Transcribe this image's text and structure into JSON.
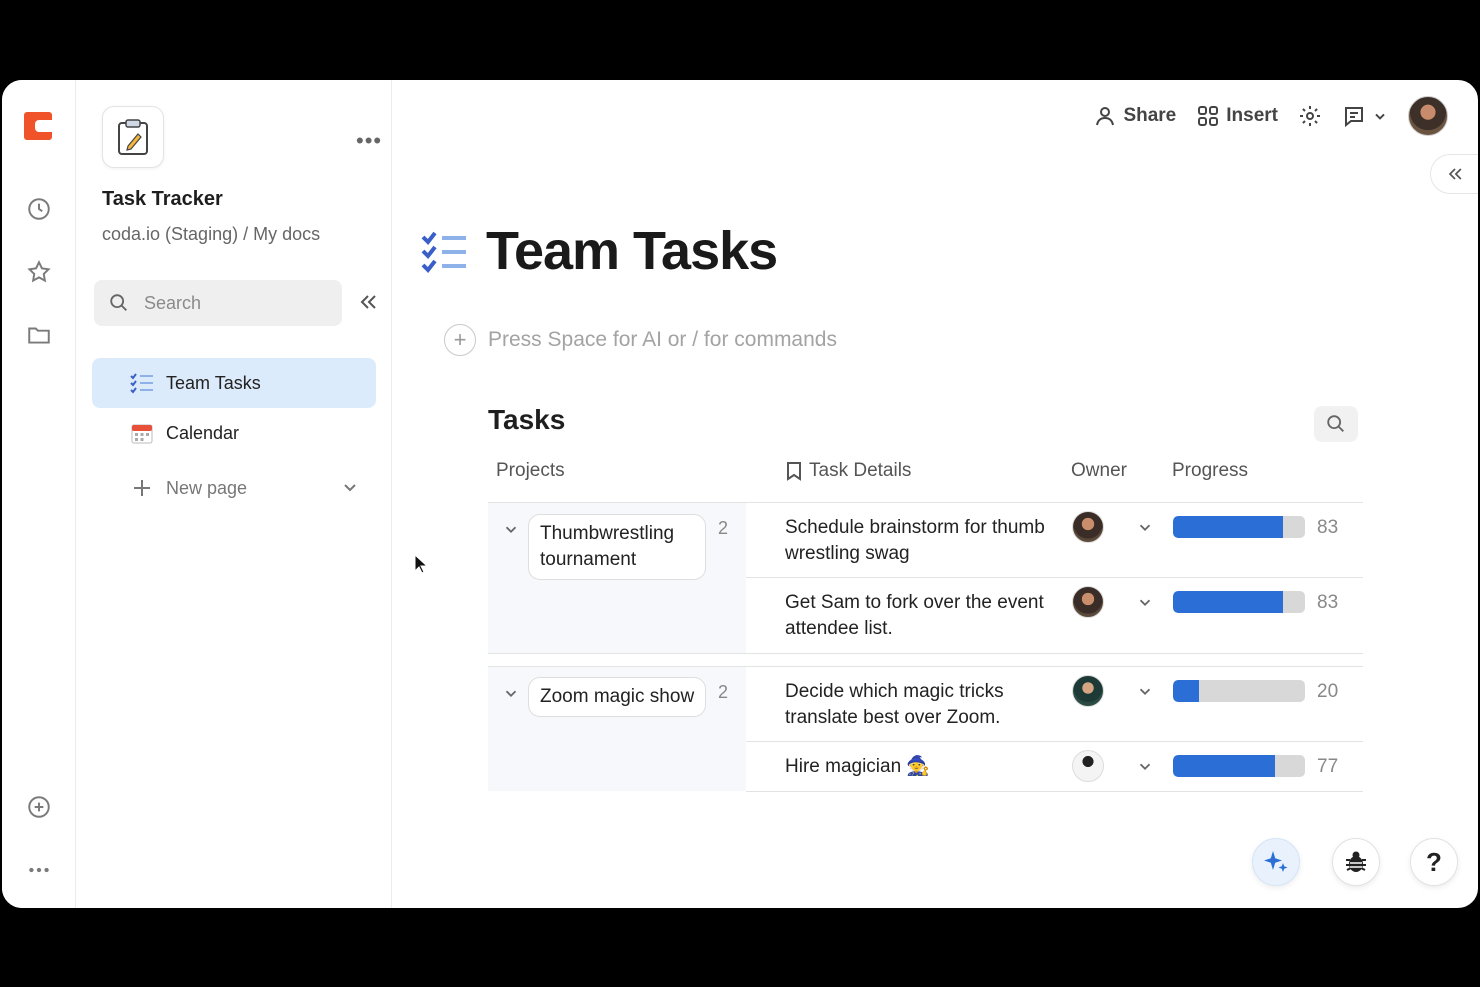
{
  "app": {
    "doc_title": "Task Tracker",
    "doc_path": "coda.io (Staging) / My docs"
  },
  "sidebar": {
    "search_placeholder": "Search",
    "items": [
      {
        "label": "Team Tasks",
        "icon": "checklist-icon",
        "active": true
      },
      {
        "label": "Calendar",
        "icon": "calendar-icon",
        "active": false
      }
    ],
    "new_page_label": "New page"
  },
  "topbar": {
    "share_label": "Share",
    "insert_label": "Insert"
  },
  "page": {
    "title": "Team Tasks",
    "command_placeholder": "Press Space for AI or / for commands"
  },
  "table": {
    "title": "Tasks",
    "columns": [
      "Projects",
      "Task Details",
      "Owner",
      "Progress"
    ],
    "groups": [
      {
        "project": "Thumbwrestling tournament",
        "count": "2",
        "tasks": [
          {
            "details": "Schedule brainstorm for thumb wrestling swag",
            "progress": 83,
            "progress_label": "83"
          },
          {
            "details": "Get Sam to fork over the event attendee list.",
            "progress": 83,
            "progress_label": "83"
          }
        ]
      },
      {
        "project": "Zoom magic show",
        "count": "2",
        "tasks": [
          {
            "details": "Decide which magic tricks translate best over Zoom.",
            "progress": 20,
            "progress_label": "20"
          },
          {
            "details": "Hire magician 🧙",
            "progress": 77,
            "progress_label": "77"
          }
        ]
      }
    ]
  },
  "colors": {
    "accent": "#2b6fd6",
    "active_nav": "#dcebfb",
    "brand": "#f0532a"
  }
}
